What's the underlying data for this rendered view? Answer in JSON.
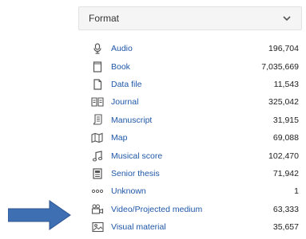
{
  "facet": {
    "title": "Format",
    "toggle_icon": "chevron-down-icon",
    "items": [
      {
        "label": "Audio",
        "count": "196,704",
        "icon": "microphone-icon"
      },
      {
        "label": "Book",
        "count": "7,035,669",
        "icon": "book-icon"
      },
      {
        "label": "Data file",
        "count": "11,543",
        "icon": "file-icon"
      },
      {
        "label": "Journal",
        "count": "325,042",
        "icon": "open-book-icon"
      },
      {
        "label": "Manuscript",
        "count": "31,915",
        "icon": "scroll-icon"
      },
      {
        "label": "Map",
        "count": "69,088",
        "icon": "map-icon"
      },
      {
        "label": "Musical score",
        "count": "102,470",
        "icon": "music-note-icon"
      },
      {
        "label": "Senior thesis",
        "count": "71,942",
        "icon": "thesis-icon"
      },
      {
        "label": "Unknown",
        "count": "1",
        "icon": "ellipsis-icon"
      },
      {
        "label": "Video/Projected medium",
        "count": "63,333",
        "icon": "video-camera-icon"
      },
      {
        "label": "Visual material",
        "count": "35,657",
        "icon": "picture-icon"
      }
    ]
  },
  "colors": {
    "link": "#1f57a8",
    "icon": "#555555",
    "header_bg": "#f5f5f5",
    "arrow": "#3f6fb3"
  },
  "annotation": {
    "icon": "right-arrow-icon"
  }
}
